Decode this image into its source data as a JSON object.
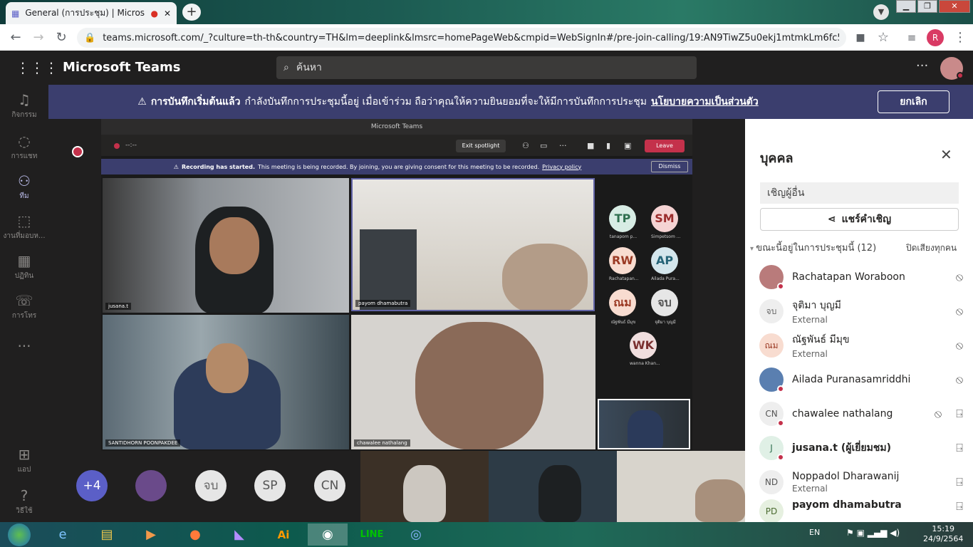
{
  "browser": {
    "tab_title": "General (การประชุม) | Microsoft Teams",
    "new_tab": "+",
    "url": "teams.microsoft.com/_?culture=th-th&country=TH&lm=deeplink&lmsrc=homePageWeb&cmpid=WebSignIn#/pre-join-calling/19:AN9TiwZ5u0ekj1mtmkLm6fc529s5P...",
    "profile_initial": "R"
  },
  "teams": {
    "app_name": "Microsoft Teams",
    "search_placeholder": "ค้นหา",
    "more": "···"
  },
  "rail": [
    {
      "label": "กิจกรรม",
      "icon": "bell-icon"
    },
    {
      "label": "การแชท",
      "icon": "chat-icon"
    },
    {
      "label": "ทีม",
      "icon": "teams-icon"
    },
    {
      "label": "งานที่มอบห...",
      "icon": "assignments-icon"
    },
    {
      "label": "ปฏิทิน",
      "icon": "calendar-icon"
    },
    {
      "label": "การโทร",
      "icon": "phone-icon"
    },
    {
      "label": "···",
      "icon": "more-icon"
    },
    {
      "label": "แอป",
      "icon": "apps-icon"
    },
    {
      "label": "วิธีใช้",
      "icon": "help-icon"
    }
  ],
  "banner": {
    "bold": "การบันทึกเริ่มต้นแล้ว",
    "text": "กำลังบันทึกการประชุมนี้อยู่ เมื่อเข้าร่วม ถือว่าคุณให้ความยินยอมที่จะให้มีการบันทึกการประชุม",
    "link": "นโยบายความเป็นส่วนตัว",
    "cancel": "ยกเลิก"
  },
  "inner": {
    "title": "Microsoft Teams",
    "time": "--:--",
    "exit_spotlight": "Exit spotlight",
    "leave": "Leave",
    "rec_bold": "Recording has started.",
    "rec_text": "This meeting is being recorded. By joining, you are giving consent for this meeting to be recorded.",
    "rec_link": "Privacy policy",
    "dismiss": "Dismiss",
    "videos": [
      {
        "name": "jusana.t"
      },
      {
        "name": "payom dhamabutra"
      },
      {
        "name": "SANTIDHORN POONPAKDEE"
      },
      {
        "name": "chawalee nathalang"
      }
    ],
    "participants": [
      {
        "init": "TP",
        "label": "tanapom p...",
        "bg": "#d7ece4",
        "fg": "#2f6f4f"
      },
      {
        "init": "SM",
        "label": "Simpetsom ...",
        "bg": "#f5d3d3",
        "fg": "#9b2c2c"
      },
      {
        "init": "RW",
        "label": "Rachatapan...",
        "bg": "#f8dcd0",
        "fg": "#9b3a24"
      },
      {
        "init": "AP",
        "label": "Ailada Pura...",
        "bg": "#d4e6ec",
        "fg": "#256477"
      },
      {
        "init": "ณม",
        "label": "ณัฐพันธ์ มีมุข",
        "bg": "#f8dcd0",
        "fg": "#9b3a24"
      },
      {
        "init": "จบ",
        "label": "จุติมา บุญมี",
        "bg": "#e6e6e6",
        "fg": "#555"
      },
      {
        "init": "WK",
        "label": "wanna Khan...",
        "bg": "#f0dede",
        "fg": "#7a2f2f"
      }
    ]
  },
  "strip": [
    {
      "init": "+4",
      "bg": "#5b5fc7",
      "fg": "#fff"
    },
    {
      "init": "จบ",
      "bg": "#e6e6e6",
      "fg": "#666"
    },
    {
      "init": "SP",
      "bg": "#e6e6e6",
      "fg": "#555"
    },
    {
      "init": "CN",
      "bg": "#e6e6e6",
      "fg": "#555"
    }
  ],
  "panel": {
    "title": "บุคคล",
    "invite_placeholder": "เชิญผู้อื่น",
    "share": "แชร์คำเชิญ",
    "in_meeting": "ขณะนี้อยู่ในการประชุมนี้ (12)",
    "mute_all": "ปิดเสียงทุกคน",
    "people": [
      {
        "name": "Rachatapan Woraboon",
        "sub": "",
        "init": "",
        "bg": "#b97b7b",
        "fg": "#fff",
        "bold": false
      },
      {
        "name": "จุติมา บุญมี",
        "sub": "External",
        "init": "จบ",
        "bg": "#eeeeee",
        "fg": "#666",
        "bold": false
      },
      {
        "name": "ณัฐพันธ์ มีมุข",
        "sub": "External",
        "init": "ณม",
        "bg": "#f8dcd0",
        "fg": "#9b3a24",
        "bold": false
      },
      {
        "name": "Ailada Puranasamriddhi",
        "sub": "",
        "init": "",
        "bg": "#5a7fb0",
        "fg": "#fff",
        "bold": false
      },
      {
        "name": "chawalee nathalang",
        "sub": "",
        "init": "CN",
        "bg": "#eeeeee",
        "fg": "#555",
        "bold": false
      },
      {
        "name": "jusana.t (ผู้เยี่ยมชม)",
        "sub": "",
        "init": "J",
        "bg": "#e0f0e6",
        "fg": "#2f6f4f",
        "bold": true
      },
      {
        "name": "Noppadol Dharawanij",
        "sub": "External",
        "init": "ND",
        "bg": "#eeeeee",
        "fg": "#555",
        "bold": false
      },
      {
        "name": "payom dhamabutra",
        "sub": "",
        "init": "PD",
        "bg": "#e6f0e0",
        "fg": "#4a6a2f",
        "bold": true
      }
    ]
  },
  "taskbar": {
    "lang": "EN",
    "time": "15:19",
    "date": "24/9/2564"
  }
}
